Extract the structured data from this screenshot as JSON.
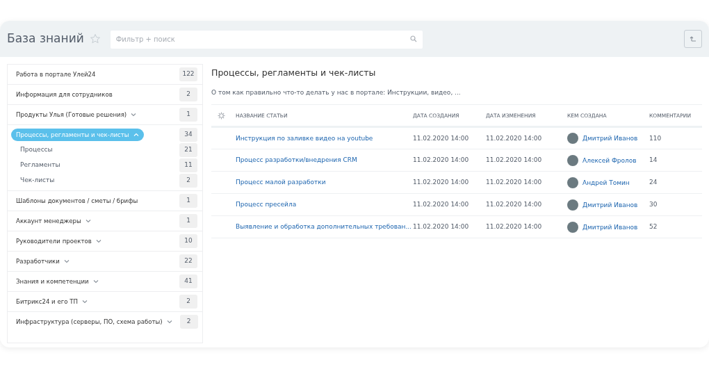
{
  "header": {
    "title": "База знаний",
    "search": {
      "placeholder": "Фильтр + поиск"
    }
  },
  "sidebar": {
    "items": [
      {
        "kind": "plain",
        "label": "Работа в портале Улей24",
        "count": "122",
        "selected": false
      },
      {
        "kind": "plain",
        "label": "Информация для сотрудников",
        "count": "2",
        "selected": false
      },
      {
        "kind": "group",
        "label": "Продукты Улья (Готовые решения)",
        "count": "1",
        "selected": false,
        "expanded": false
      },
      {
        "kind": "group",
        "label": "Процессы, регламенты и чек-листы",
        "count": "34",
        "selected": true,
        "expanded": true,
        "children": [
          {
            "label": "Процессы",
            "count": "21"
          },
          {
            "label": "Регламенты",
            "count": "11"
          },
          {
            "label": "Чек-листы",
            "count": "2"
          }
        ]
      },
      {
        "kind": "plain",
        "label": "Шаблоны документов / сметы / брифы",
        "count": "1",
        "selected": false
      },
      {
        "kind": "group",
        "label": "Аккаунт менеджеры",
        "count": "1",
        "selected": false,
        "expanded": false
      },
      {
        "kind": "group",
        "label": "Руководители проектов",
        "count": "10",
        "selected": false,
        "expanded": false
      },
      {
        "kind": "group",
        "label": "Разработчики",
        "count": "22",
        "selected": false,
        "expanded": false
      },
      {
        "kind": "group",
        "label": "Знания и компетенции",
        "count": "41",
        "selected": false,
        "expanded": false
      },
      {
        "kind": "group",
        "label": "Битрикс24 и его ТП",
        "count": "2",
        "selected": false,
        "expanded": false
      },
      {
        "kind": "group",
        "label": "Инфраструктура (серверы, ПО, схема работы)",
        "count": "2",
        "selected": false,
        "expanded": false
      }
    ]
  },
  "content": {
    "title": "Процессы, регламенты и чек-листы",
    "description": "О том как правильно что-то делать у нас в портале: Инструкции, видео, ...",
    "table": {
      "columns": [
        "НАЗВАНИЕ СТАТЬИ",
        "ДАТА СОЗДАНИЯ",
        "ДАТА ИЗМЕНЕНИЯ",
        "КЕМ СОЗДАНА",
        "КОММЕНТАРИИ"
      ],
      "rows": [
        {
          "title": "Инструкция по заливке видео на youtube",
          "created": "11.02.2020 14:00",
          "modified": "11.02.2020 14:00",
          "author": "Дмитрий Иванов",
          "comments": "110"
        },
        {
          "title": "Процесс разработки/внедрения CRM",
          "created": "11.02.2020 14:00",
          "modified": "11.02.2020 14:00",
          "author": "Алексей Фролов",
          "comments": "14"
        },
        {
          "title": "Процесс малой разработки",
          "created": "11.02.2020 14:00",
          "modified": "11.02.2020 14:00",
          "author": "Андрей Томин",
          "comments": "24"
        },
        {
          "title": "Процесс пресейла",
          "created": "11.02.2020 14:00",
          "modified": "11.02.2020 14:00",
          "author": "Дмитрий Иванов",
          "comments": "30"
        },
        {
          "title": "Выявление и обработка дополнительных требован...",
          "created": "11.02.2020 14:00",
          "modified": "11.02.2020 14:00",
          "author": "Дмитрий Иванов",
          "comments": "52"
        }
      ]
    }
  }
}
